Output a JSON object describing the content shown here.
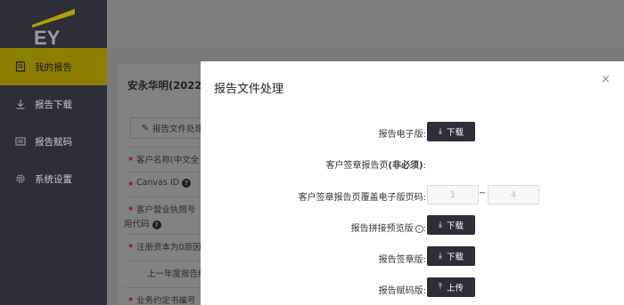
{
  "brand": {
    "logo_text": "EY",
    "accent": "#ffe600",
    "dark": "#2e2e38"
  },
  "sidebar": {
    "items": [
      {
        "label": "我的报告",
        "icon": "report-icon",
        "active": true
      },
      {
        "label": "报告下载",
        "icon": "download-icon",
        "active": false
      },
      {
        "label": "报告赋码",
        "icon": "barcode-icon",
        "active": false
      },
      {
        "label": "系统设置",
        "icon": "gear-icon",
        "active": false
      }
    ]
  },
  "panel": {
    "title": "安永华明(2022)",
    "action_label": "报告文件处理",
    "fields": [
      {
        "label": "客户名称(中文全",
        "required": true,
        "help": false
      },
      {
        "label": "Canvas ID",
        "required": true,
        "help": true
      },
      {
        "label": "客户营业执照号",
        "label_line2": "用代码",
        "required": true,
        "help": true
      },
      {
        "label": "注册资本为0原因",
        "required": true,
        "help": false
      },
      {
        "label": "上一年度报告编",
        "required": false,
        "help": false
      },
      {
        "label": "业务约定书编号",
        "required": true,
        "help": false
      }
    ]
  },
  "modal": {
    "title": "报告文件处理",
    "close": "×",
    "rows": [
      {
        "label": "报告电子版:",
        "button": "下载",
        "button_icon": "download-icon"
      },
      {
        "label": "客户签章报告页",
        "label_bold": "(非必须)",
        "label_suffix": ":"
      },
      {
        "label": "客户签章报告页覆盖电子版页码:",
        "from_placeholder": "1",
        "to_placeholder": "4",
        "sep": "~"
      },
      {
        "label": "报告拼接预览版",
        "label_suffix": ":",
        "info": "i",
        "button": "下载",
        "button_icon": "download-icon"
      },
      {
        "label": "报告签章版:",
        "button": "下载",
        "button_icon": "download-icon"
      },
      {
        "label": "报告赋码版:",
        "button": "上传",
        "button_icon": "upload-icon"
      }
    ]
  }
}
